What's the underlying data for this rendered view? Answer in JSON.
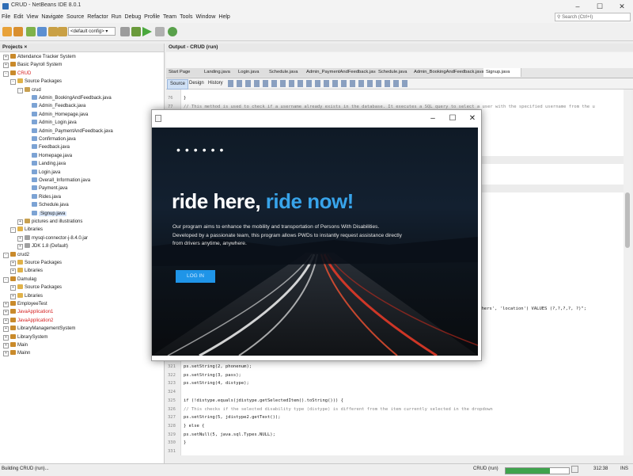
{
  "window": {
    "title": "CRUD - NetBeans IDE 8.0.1",
    "minimize": "–",
    "maximize": "☐",
    "close": "✕"
  },
  "menu": [
    "File",
    "Edit",
    "View",
    "Navigate",
    "Source",
    "Refactor",
    "Run",
    "Debug",
    "Profile",
    "Team",
    "Tools",
    "Window",
    "Help"
  ],
  "search": {
    "placeholder": "Search (Ctrl+I)"
  },
  "toolbar": {
    "config": "<default config>"
  },
  "projects": {
    "header": "Projects ×",
    "items": [
      {
        "label": "Attendance Tracker System",
        "indent": 0,
        "type": "project",
        "red": false,
        "exp": "+"
      },
      {
        "label": "Basic Payroll System",
        "indent": 0,
        "type": "project",
        "red": false,
        "exp": "+"
      },
      {
        "label": "CRUD",
        "indent": 0,
        "type": "project",
        "red": true,
        "exp": "-"
      },
      {
        "label": "Source Packages",
        "indent": 1,
        "type": "folder",
        "red": false,
        "exp": "-"
      },
      {
        "label": "crud",
        "indent": 2,
        "type": "package",
        "red": false,
        "exp": "-"
      },
      {
        "label": "Admin_BookingAndFeedback.java",
        "indent": 3,
        "type": "file",
        "red": false,
        "exp": ""
      },
      {
        "label": "Admin_Feedback.java",
        "indent": 3,
        "type": "file",
        "red": false,
        "exp": ""
      },
      {
        "label": "Admin_Homepage.java",
        "indent": 3,
        "type": "file",
        "red": false,
        "exp": ""
      },
      {
        "label": "Admin_Login.java",
        "indent": 3,
        "type": "file",
        "red": false,
        "exp": ""
      },
      {
        "label": "Admin_PaymentAndFeedback.java",
        "indent": 3,
        "type": "file",
        "red": false,
        "exp": ""
      },
      {
        "label": "Confirmation.java",
        "indent": 3,
        "type": "file",
        "red": false,
        "exp": ""
      },
      {
        "label": "Feedback.java",
        "indent": 3,
        "type": "file",
        "red": false,
        "exp": ""
      },
      {
        "label": "Homepage.java",
        "indent": 3,
        "type": "file",
        "red": false,
        "exp": ""
      },
      {
        "label": "Landing.java",
        "indent": 3,
        "type": "file",
        "red": false,
        "exp": ""
      },
      {
        "label": "Login.java",
        "indent": 3,
        "type": "file",
        "red": false,
        "exp": ""
      },
      {
        "label": "Overall_Information.java",
        "indent": 3,
        "type": "file",
        "red": false,
        "exp": ""
      },
      {
        "label": "Payment.java",
        "indent": 3,
        "type": "file",
        "red": false,
        "exp": ""
      },
      {
        "label": "Rides.java",
        "indent": 3,
        "type": "file",
        "red": false,
        "exp": ""
      },
      {
        "label": "Schedule.java",
        "indent": 3,
        "type": "file",
        "red": false,
        "exp": ""
      },
      {
        "label": "Signup.java",
        "indent": 3,
        "type": "file",
        "red": false,
        "exp": "",
        "selected": true
      },
      {
        "label": "pictures and illustrations",
        "indent": 2,
        "type": "package",
        "red": false,
        "exp": "+"
      },
      {
        "label": "Libraries",
        "indent": 1,
        "type": "folder",
        "red": false,
        "exp": "-"
      },
      {
        "label": "mysql-connector-j-8.4.0.jar",
        "indent": 2,
        "type": "jar",
        "red": false,
        "exp": "+"
      },
      {
        "label": "JDK 1.8 (Default)",
        "indent": 2,
        "type": "jar",
        "red": false,
        "exp": "+"
      },
      {
        "label": "crud2",
        "indent": 0,
        "type": "project",
        "red": false,
        "exp": "-"
      },
      {
        "label": "Source Packages",
        "indent": 1,
        "type": "folder",
        "red": false,
        "exp": "+"
      },
      {
        "label": "Libraries",
        "indent": 1,
        "type": "folder",
        "red": false,
        "exp": "+"
      },
      {
        "label": "Damulag",
        "indent": 0,
        "type": "project",
        "red": false,
        "exp": "-"
      },
      {
        "label": "Source Packages",
        "indent": 1,
        "type": "folder",
        "red": false,
        "exp": "+"
      },
      {
        "label": "Libraries",
        "indent": 1,
        "type": "folder",
        "red": false,
        "exp": "+"
      },
      {
        "label": "EmployeeTest",
        "indent": 0,
        "type": "project",
        "red": false,
        "exp": "+"
      },
      {
        "label": "JavaApplication1",
        "indent": 0,
        "type": "project",
        "red": true,
        "exp": "+"
      },
      {
        "label": "JavaApplication2",
        "indent": 0,
        "type": "project",
        "red": true,
        "exp": "+"
      },
      {
        "label": "LibraryManagementSystem",
        "indent": 0,
        "type": "project",
        "red": false,
        "exp": "+"
      },
      {
        "label": "LibrarySystem",
        "indent": 0,
        "type": "project",
        "red": false,
        "exp": "+"
      },
      {
        "label": "Main",
        "indent": 0,
        "type": "project",
        "red": false,
        "exp": "+"
      },
      {
        "label": "Mainn",
        "indent": 0,
        "type": "project",
        "red": false,
        "exp": "+"
      }
    ]
  },
  "output": {
    "title": "Output - CRUD (run)"
  },
  "editor": {
    "tabs": [
      "Start Page",
      "Landing.java",
      "Login.java",
      "Schedule.java",
      "Admin_PaymentAndFeedback.java",
      "Schedule.java",
      "Admin_BookingAndFeedback.java",
      "Signup.java"
    ],
    "views": [
      "Source",
      "Design",
      "History"
    ],
    "top_lines": [
      {
        "n": "76",
        "text": "        }",
        "cls": ""
      },
      {
        "n": "77",
        "text": "//     This method is used to check if a username already exists in the database. It executes a SQL query to select a user with the specified username from the u",
        "cls": "cmt"
      }
    ],
    "right_fragment": "others', 'location') VALUES (?,?,?,?, ?)\";",
    "bottom_lines": [
      {
        "n": "321",
        "text": "            ps.setString(2, phonenum);",
        "cls": ""
      },
      {
        "n": "322",
        "text": "            ps.setString(3, pass);",
        "cls": ""
      },
      {
        "n": "323",
        "text": "            ps.setString(4, distype);",
        "cls": ""
      },
      {
        "n": "324",
        "text": "",
        "cls": ""
      },
      {
        "n": "325",
        "text": "            if (!distype.equals(jdistype.getSelectedItem().toString())) {",
        "cls": ""
      },
      {
        "n": "326",
        "text": "//             This checks if the selected disability type (distype) is different from the item currently selected in the dropdown",
        "cls": "cmt"
      },
      {
        "n": "327",
        "text": "                ps.setString(5, jdistype2.getText());",
        "cls": ""
      },
      {
        "n": "328",
        "text": "            } else {",
        "cls": ""
      },
      {
        "n": "329",
        "text": "                ps.setNull(5, java.sql.Types.NULL);",
        "cls": ""
      },
      {
        "n": "330",
        "text": "            }",
        "cls": ""
      },
      {
        "n": "331",
        "text": "",
        "cls": ""
      }
    ]
  },
  "dialog": {
    "dots": "••••••",
    "headline_white": "ride here, ",
    "headline_blue": "ride now!",
    "description": "Our program aims to enhance the mobility and transportation of Persons With Disabilities. Developed by a passionate team, this program allows PWDs to instantly request assistance directly from drivers anytime, anywhere.",
    "login_label": "LOG IN"
  },
  "status": {
    "left": "Building CRUD (run)...",
    "project": "CRUD (run)",
    "position": "312:38",
    "mode": "INS"
  },
  "colors": {
    "accent": "#38a4ea",
    "button": "#1f95e8"
  }
}
